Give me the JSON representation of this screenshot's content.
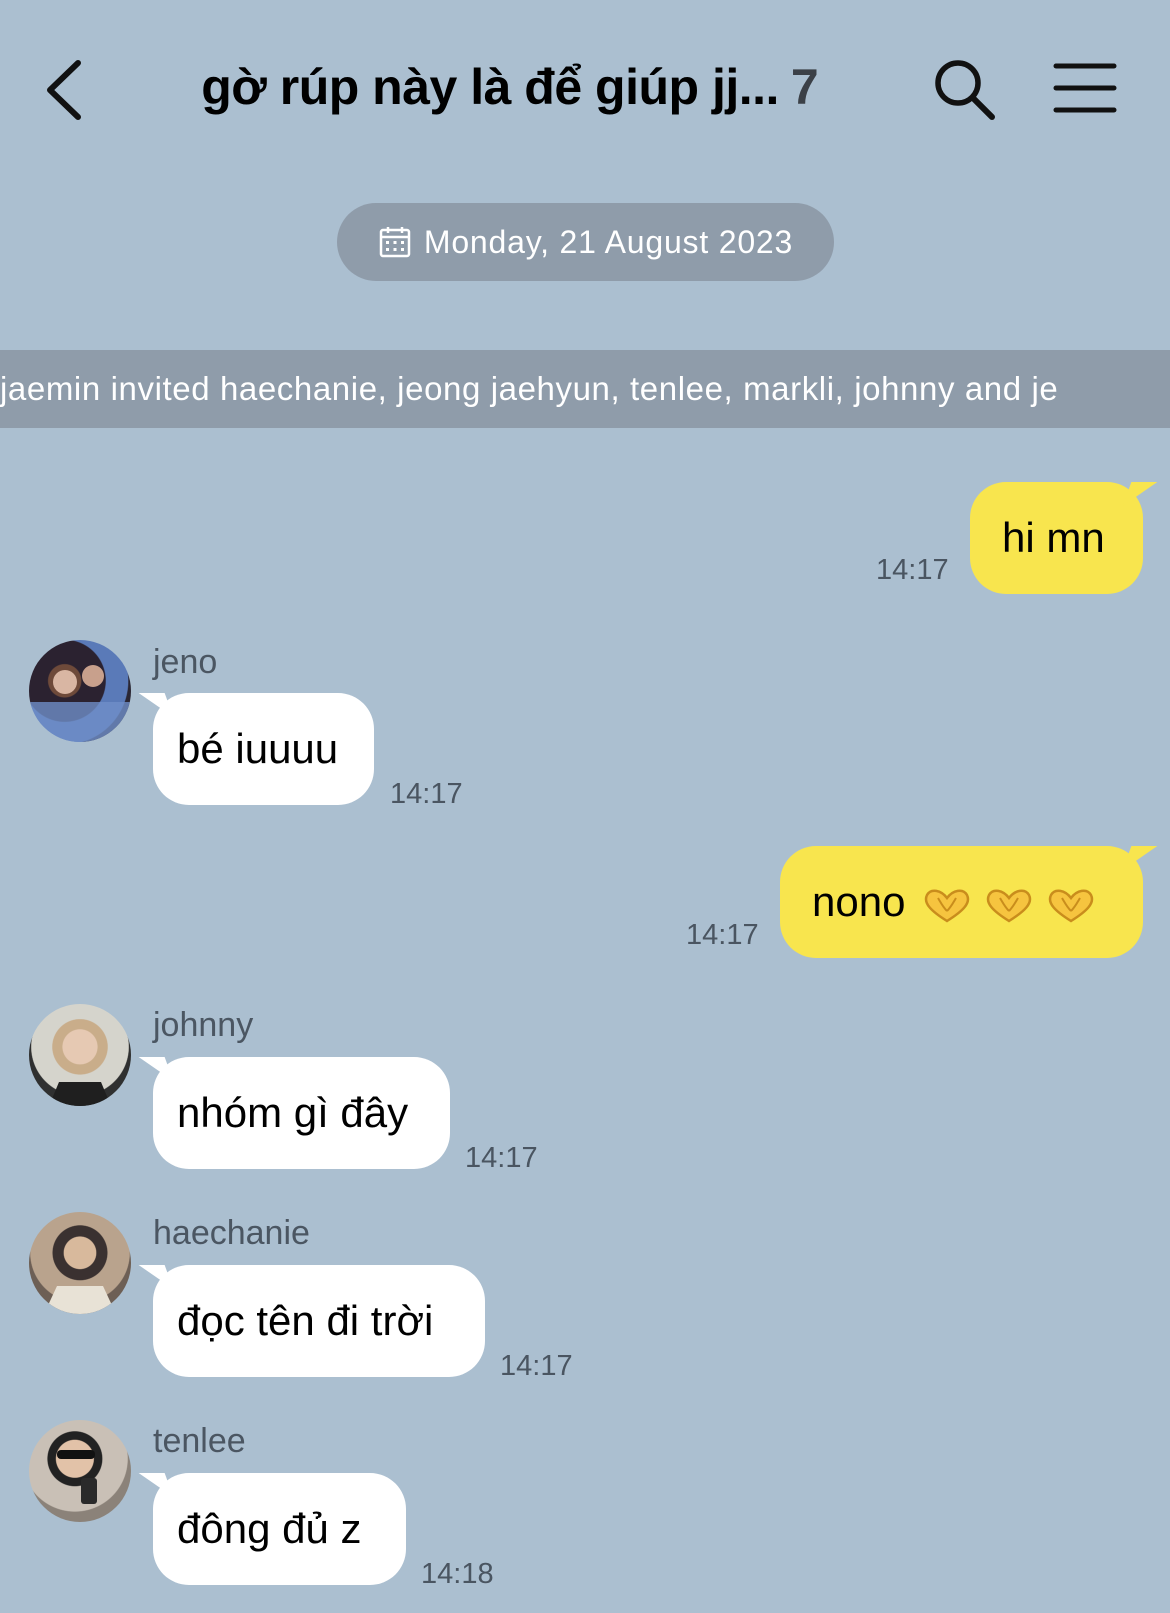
{
  "header": {
    "title": "gờ rúp này là để giúp jj...",
    "member_count": "7"
  },
  "date_divider": "Monday, 21 August 2023",
  "system_notice": "jaemin invited haechanie, jeong jaehyun, tenlee, markli, johnny and je",
  "messages": [
    {
      "from": "me",
      "text": "hi mn",
      "time": "14:17"
    },
    {
      "from": "jeno",
      "text": "bé iuuuu",
      "time": "14:17"
    },
    {
      "from": "me",
      "text": "nono",
      "time": "14:17",
      "emoji_count": 3,
      "emoji_icon": "heart-hands-icon"
    },
    {
      "from": "johnny",
      "text": "nhóm gì đây",
      "time": "14:17"
    },
    {
      "from": "haechanie",
      "text": "đọc tên đi trời",
      "time": "14:17"
    },
    {
      "from": "tenlee",
      "text": "đông đủ z",
      "time": "14:18"
    }
  ],
  "colors": {
    "background": "#abbfd0",
    "outgoing_bubble": "#f8e54e",
    "incoming_bubble": "#ffffff",
    "pill": "#8f9caa"
  }
}
